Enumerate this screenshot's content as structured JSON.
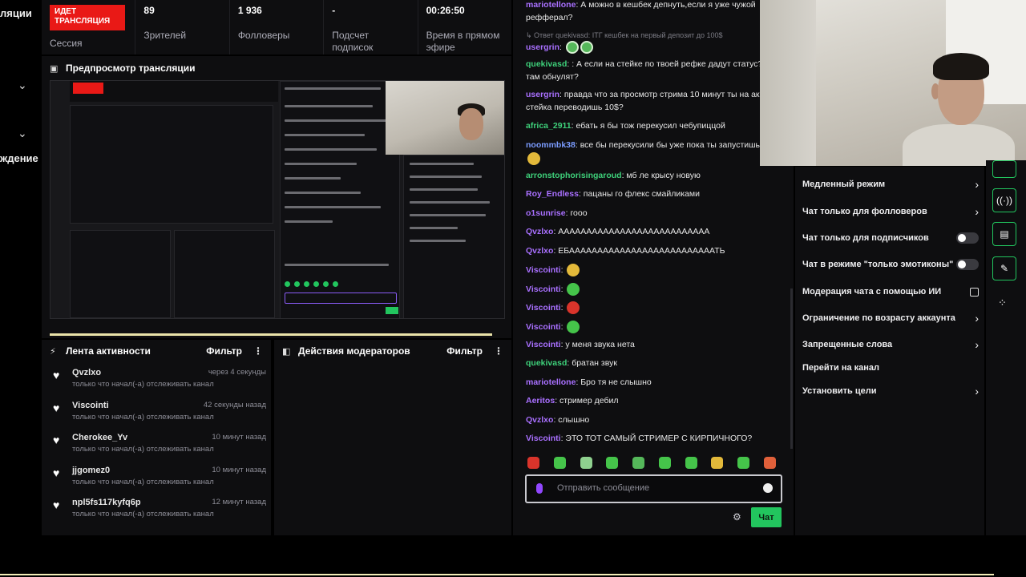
{
  "left_sidebar": {
    "fragment_top": "ляции",
    "fragment_bottom": "ждение"
  },
  "stats": {
    "live_badge": "ИДЕТ ТРАНСЛЯЦИЯ",
    "session_label": "Сессия",
    "viewers_value": "89",
    "viewers_label": "Зрителей",
    "followers_value": "1 936",
    "followers_label": "Фолловеры",
    "subs_value": "-",
    "subs_label": "Подсчет подписок",
    "uptime_value": "00:26:50",
    "uptime_label": "Время в прямом эфире"
  },
  "preview": {
    "title": "Предпросмотр трансляции"
  },
  "activity": {
    "title": "Лента активности",
    "filter_label": "Фильтр",
    "items": [
      {
        "name": "Qvzlxo",
        "action": "только что начал(-а) отслеживать канал",
        "time": "через 4 секунды"
      },
      {
        "name": "Viscointi",
        "action": "только что начал(-а) отслеживать канал",
        "time": "42 секунды назад"
      },
      {
        "name": "Cherokee_Yv",
        "action": "только что начал(-а) отслеживать канал",
        "time": "10 минут назад"
      },
      {
        "name": "jjgomez0",
        "action": "только что начал(-а) отслеживать канал",
        "time": "10 минут назад"
      },
      {
        "name": "npl5fs117kyfq6p",
        "action": "только что начал(-а) отслеживать канал",
        "time": "12 минут назад"
      }
    ]
  },
  "mod_actions": {
    "title": "Действия модераторов",
    "filter_label": "Фильтр"
  },
  "chat": {
    "messages": [
      {
        "user": "mariotellone",
        "text": ": А можно в кешбек депнуть,если я уже чужой",
        "color": "#a970ff"
      },
      {
        "user": "",
        "text": "рефферал?",
        "color": ""
      },
      {
        "user": "",
        "text": "↳ Ответ quekivasd: ITГ кешбек на первый депозит до 100$",
        "color": ""
      },
      {
        "user": "usergrin",
        "text": ":",
        "color": "#a970ff"
      },
      {
        "user": "quekivasd",
        "text": ": : А если на стейке по твоей рефке дадут статус?",
        "color": "#3ed07a"
      },
      {
        "user": "",
        "text": "там обнулят?",
        "color": ""
      },
      {
        "user": "usergrin",
        "text": ": правда что за просмотр стрима 10 минут ты на акк",
        "color": "#a970ff"
      },
      {
        "user": "",
        "text": "стейка переводишь 10$?",
        "color": ""
      },
      {
        "user": "africa_2911",
        "text": ": ебать я бы тож перекусил чебупиццой",
        "color": "#3ed07a"
      },
      {
        "user": "noommbk38",
        "text": ": все бы перекусили бы уже пока ты запустишь",
        "color": "#7b9cff"
      },
      {
        "user": "arronstophorisingaroud",
        "text": ": мб ле крысу новую",
        "color": "#3ed07a"
      },
      {
        "user": "Roy_Endless",
        "text": ": пацаны го флекс смайликами",
        "color": "#a970ff"
      },
      {
        "user": "o1sunrise",
        "text": ": гооо",
        "color": "#a970ff"
      },
      {
        "user": "Qvzlxo",
        "text": ": ААААААААААААААААААААААААААА",
        "color": "#a970ff"
      },
      {
        "user": "Qvzlxo",
        "text": ": ЕБААААААААААААААААААААААААААТЬ",
        "color": "#a970ff"
      },
      {
        "user": "Viscointi",
        "text": ":",
        "color": "#a970ff"
      },
      {
        "user": "Viscointi",
        "text": ":",
        "color": "#a970ff"
      },
      {
        "user": "Viscointi",
        "text": ":",
        "color": "#a970ff"
      },
      {
        "user": "Viscointi",
        "text": ":",
        "color": "#a970ff"
      },
      {
        "user": "Viscointi",
        "text": ": у меня звука нета",
        "color": "#a970ff"
      },
      {
        "user": "quekivasd",
        "text": ": братан звук",
        "color": "#3ed07a"
      },
      {
        "user": "mariotellone",
        "text": ": Бро тя не слышно",
        "color": "#a970ff"
      },
      {
        "user": "Aeritos",
        "text": ": стример дебил",
        "color": "#a970ff"
      },
      {
        "user": "Qvzlxo",
        "text": ": слышно",
        "color": "#a970ff"
      },
      {
        "user": "Viscointi",
        "text": ": ЭТО ТОТ САМЫЙ СТРИМЕР С КИРПИЧНОГО?",
        "color": "#a970ff"
      }
    ],
    "input_placeholder": "Отправить сообщение",
    "send_label": "Чат"
  },
  "moderation": {
    "items": [
      {
        "label": "Медленный режим",
        "control": "chevron"
      },
      {
        "label": "Чат только для фолловеров",
        "control": "chevron"
      },
      {
        "label": "Чат только для подписчиков",
        "control": "toggle"
      },
      {
        "label": "Чат в режиме \"только эмотиконы\"",
        "control": "toggle"
      },
      {
        "label": "Модерация чата с помощью ИИ",
        "control": "external"
      },
      {
        "label": "Ограничение по возрасту аккаунта",
        "control": "chevron"
      },
      {
        "label": "Запрещенные слова",
        "control": "chevron"
      },
      {
        "label": "Перейти на канал",
        "control": "none"
      },
      {
        "label": "Установить цели",
        "control": "chevron"
      }
    ]
  },
  "colors": {
    "live_red": "#e91916",
    "accent_green": "#22c55e",
    "panel_bg": "#0e0e10",
    "username_purple": "#a970ff"
  }
}
